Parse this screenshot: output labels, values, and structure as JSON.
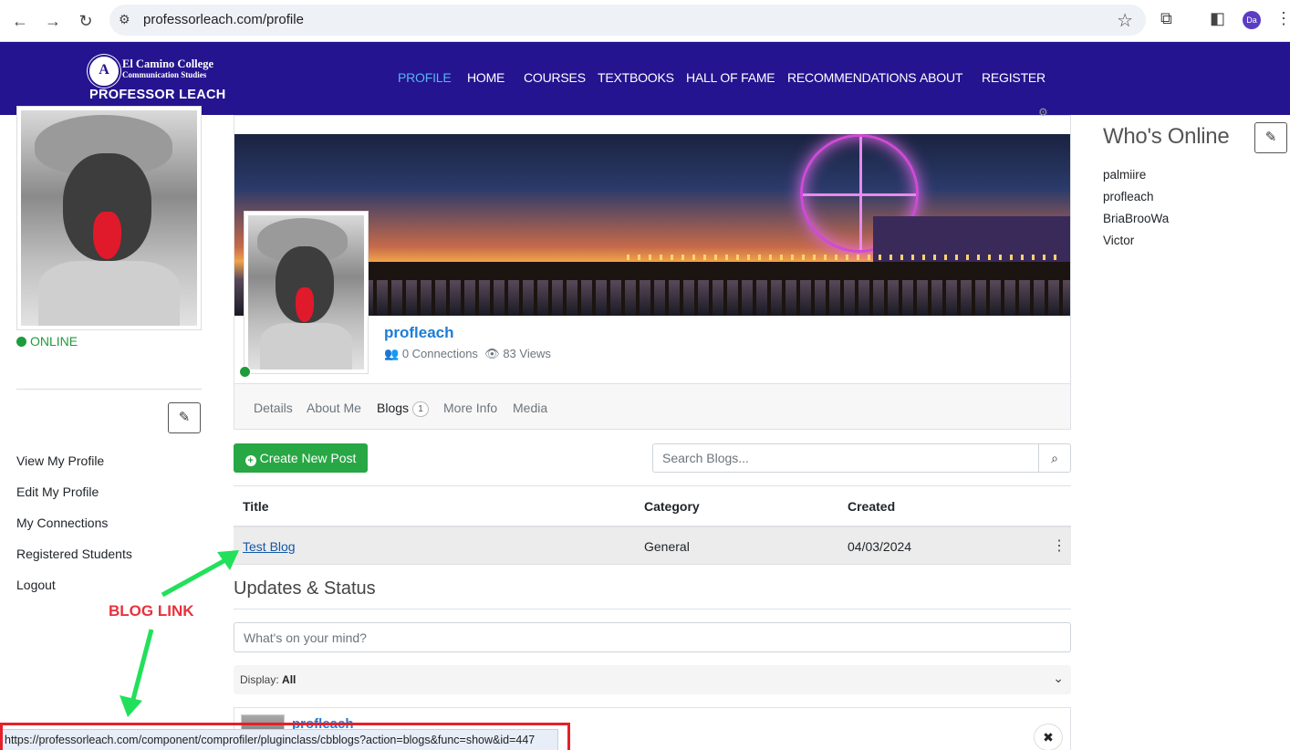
{
  "browser": {
    "url": "professorleach.com/profile",
    "profile_initials": "Da"
  },
  "site": {
    "logo": {
      "line1": "El Camino College",
      "line2": "Communication Studies",
      "line3": "PROFESSOR LEACH"
    },
    "nav": [
      {
        "label": "PROFILE",
        "active": true
      },
      {
        "label": "HOME"
      },
      {
        "label": "COURSES"
      },
      {
        "label": "TEXTBOOKS"
      },
      {
        "label": "HALL OF FAME"
      },
      {
        "label": "RECOMMENDATIONS"
      },
      {
        "label": "ABOUT"
      },
      {
        "label": "REGISTER"
      }
    ],
    "accent_color": "#24148f",
    "active_nav_color": "#5ab4f0"
  },
  "sidebar": {
    "status": "ONLINE",
    "menu": [
      "View My Profile",
      "Edit My Profile",
      "My Connections",
      "Registered Students",
      "Logout"
    ]
  },
  "profile": {
    "username": "profleach",
    "connections": "0 Connections",
    "views": "83 Views",
    "tabs": [
      {
        "label": "Details"
      },
      {
        "label": "About Me"
      },
      {
        "label": "Blogs",
        "badge": "1",
        "active": true
      },
      {
        "label": "More Info"
      },
      {
        "label": "Media"
      }
    ]
  },
  "blogs": {
    "create_label": "Create New Post",
    "search_placeholder": "Search Blogs...",
    "columns": [
      "Title",
      "Category",
      "Created"
    ],
    "rows": [
      {
        "title": "Test Blog",
        "category": "General",
        "created": "04/03/2024"
      }
    ]
  },
  "updates": {
    "title": "Updates & Status",
    "placeholder": "What's on your mind?",
    "display_label": "Display:",
    "display_value": "All",
    "post_author": "profleach"
  },
  "whos_online": {
    "title": "Who's Online",
    "users": [
      "palmiire",
      "profleach",
      "BriaBrooWa",
      "Victor"
    ]
  },
  "annotation": {
    "label": "BLOG LINK",
    "color": "#e8323c",
    "arrow_color": "#22e05a"
  },
  "statusbar": {
    "url": "https://professorleach.com/component/comprofiler/pluginclass/cbblogs?action=blogs&func=show&id=447"
  }
}
